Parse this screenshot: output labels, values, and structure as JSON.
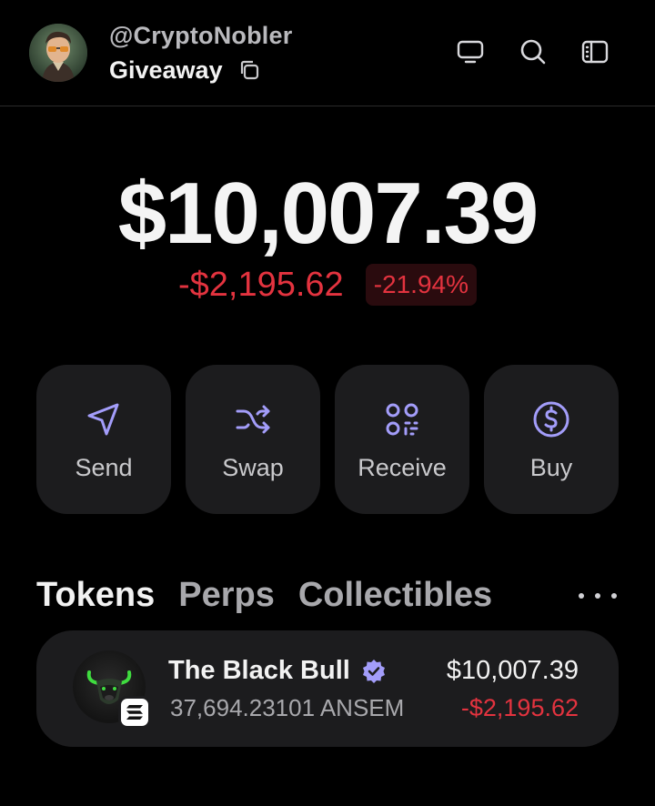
{
  "header": {
    "handle": "@CryptoNobler",
    "account_name": "Giveaway",
    "icons": [
      "monitor-icon",
      "search-icon",
      "sidebar-icon"
    ]
  },
  "balance": {
    "total": "$10,007.39",
    "change_amount": "-$2,195.62",
    "change_percent": "-21.94%"
  },
  "actions": [
    {
      "label": "Send",
      "icon": "send-icon"
    },
    {
      "label": "Swap",
      "icon": "swap-icon"
    },
    {
      "label": "Receive",
      "icon": "qr-icon"
    },
    {
      "label": "Buy",
      "icon": "dollar-circle-icon"
    }
  ],
  "tabs": [
    {
      "label": "Tokens",
      "active": true
    },
    {
      "label": "Perps",
      "active": false
    },
    {
      "label": "Collectibles",
      "active": false
    }
  ],
  "tokens": [
    {
      "name": "The Black Bull",
      "amount": "37,694.23101 ANSEM",
      "value": "$10,007.39",
      "change": "-$2,195.62",
      "verified": true
    }
  ],
  "colors": {
    "background": "#000000",
    "card": "#1c1c1e",
    "accent": "#a39dfa",
    "negative": "#e3333f"
  }
}
